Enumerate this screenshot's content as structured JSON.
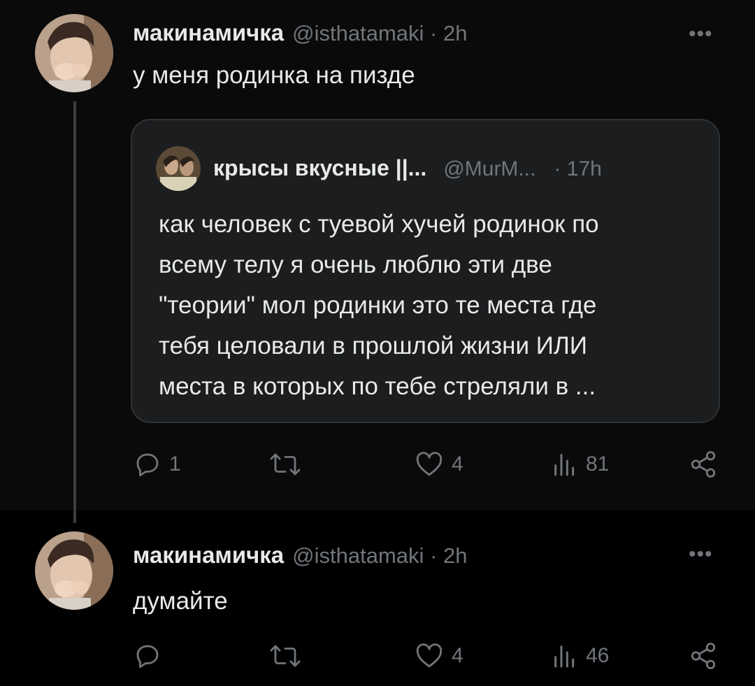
{
  "posts": [
    {
      "author_name": "макинамичка",
      "author_handle": "@isthatamaki · 2h",
      "text": "у меня родинка на пизде",
      "quoted": {
        "author_name": "крысы вкусные ||...",
        "author_handle": "@MurM...",
        "time": "· 17h",
        "lines": [
          "как человек с туевой хучей родинок по",
          "всему телу я очень люблю эти две",
          "\"теории\" мол родинки это те места где",
          "тебя целовали в прошлой жизни ИЛИ",
          "места в которых по тебе стреляли в ..."
        ]
      },
      "stats": {
        "replies": "1",
        "reposts": "",
        "likes": "4",
        "views": "81"
      }
    },
    {
      "author_name": "макинамичка",
      "author_handle": "@isthatamaki · 2h",
      "text": "думайте",
      "stats": {
        "replies": "",
        "reposts": "",
        "likes": "4",
        "views": "46"
      }
    }
  ],
  "more_label": "•••",
  "icons": [
    "reply-icon",
    "repost-icon",
    "like-icon",
    "views-icon",
    "share-icon",
    "more-icon"
  ],
  "colors": {
    "background": "#000000",
    "text": "#e7e9ea",
    "muted": "#71767b",
    "quote_bg": "#1c1d1f",
    "border": "#2f3336"
  }
}
